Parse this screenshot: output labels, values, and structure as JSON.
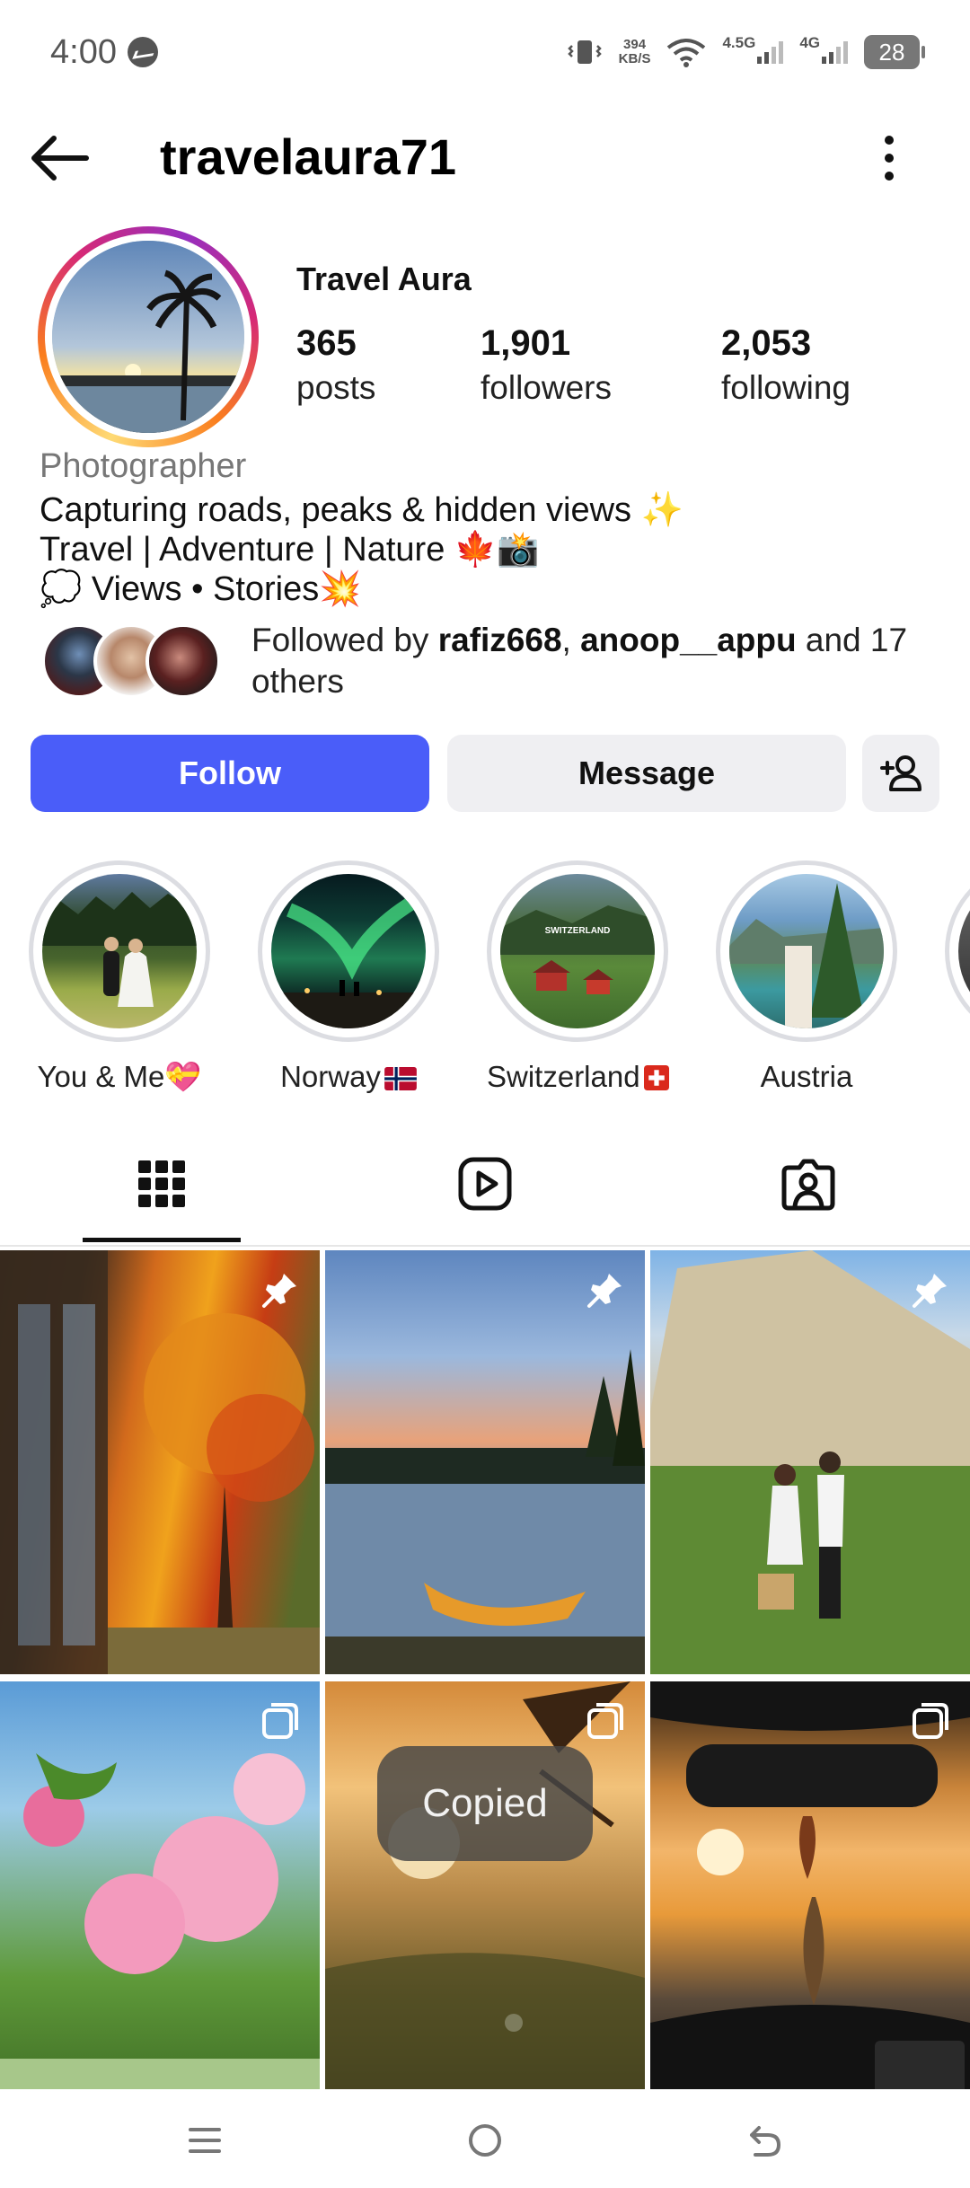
{
  "status_bar": {
    "time": "4:00",
    "speed_top": "394",
    "speed_bottom": "KB/S",
    "net1": "4.5G",
    "net2": "4G",
    "battery": "28"
  },
  "header": {
    "username": "travelaura71"
  },
  "profile": {
    "display_name": "Travel Aura",
    "stats": [
      {
        "value": "365",
        "label": "posts"
      },
      {
        "value": "1,901",
        "label": "followers"
      },
      {
        "value": "2,053",
        "label": "following"
      }
    ],
    "category": "Photographer",
    "bio": [
      "Capturing roads, peaks & hidden views ✨",
      "Travel | Adventure | Nature 🍁📸",
      "💭 Views • Stories💥"
    ],
    "followed_by": {
      "prefix": "Followed by ",
      "user1": "rafiz668",
      "separator": ", ",
      "user2": "anoop__appu",
      "suffix": " and 17 others"
    }
  },
  "actions": {
    "follow": "Follow",
    "message": "Message"
  },
  "highlights": [
    {
      "label": "You & Me💝"
    },
    {
      "label": "Norway"
    },
    {
      "label": "Switzerland"
    },
    {
      "label": "Austria"
    }
  ],
  "highlight_overlay": {
    "switzerland_text": "SWITZERLAND"
  },
  "tabs": [
    "grid",
    "reels",
    "tagged"
  ],
  "toast": "Copied",
  "colors": {
    "follow_button": "#4a5df9",
    "secondary_button": "#efeff2",
    "text_muted": "#777777"
  }
}
